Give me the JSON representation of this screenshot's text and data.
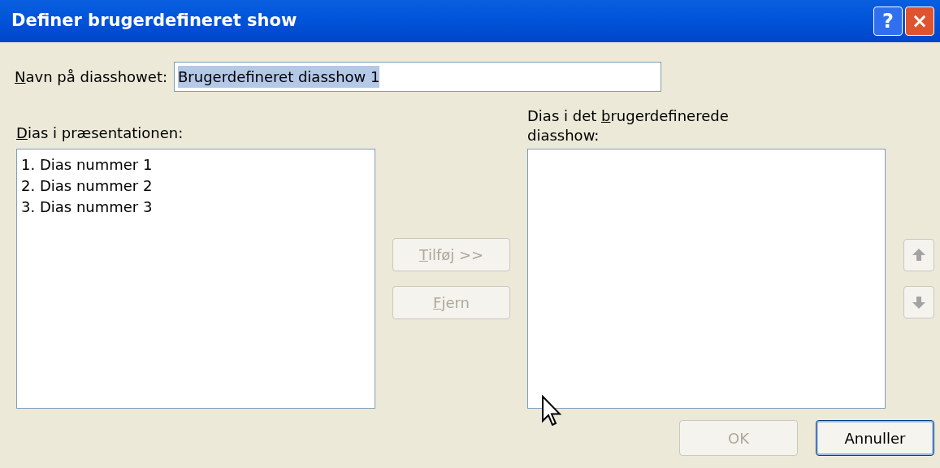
{
  "window": {
    "title": "Definer brugerdefineret show"
  },
  "title_buttons": [
    {
      "kind": "help",
      "label": "?"
    },
    {
      "kind": "close",
      "label": "×"
    }
  ],
  "name_field": {
    "label": {
      "key": "N",
      "post": "avn på diasshowet:"
    },
    "value": "Brugerdefineret diasshow 1",
    "selected": true
  },
  "left_list": {
    "label": {
      "key": "D",
      "post": "ias i præsentationen:"
    },
    "items": [
      {
        "text": "1. Dias nummer 1",
        "selected": false
      },
      {
        "text": "2. Dias nummer 2",
        "selected": false
      },
      {
        "text": "3. Dias nummer 3",
        "selected": false
      }
    ]
  },
  "middle_buttons": [
    {
      "label": {
        "key": "T",
        "post": "ilføj >>"
      },
      "disabled": true
    },
    {
      "label": {
        "key": "F",
        "post": "jern"
      },
      "disabled": true
    }
  ],
  "right_list": {
    "label": {
      "pre": "Dias i det ",
      "key": "b",
      "post": "rugerdefinerede diasshow:"
    }
  },
  "order_buttons": [
    {
      "kind": "up",
      "disabled": true
    },
    {
      "kind": "down",
      "disabled": true
    }
  ],
  "footer_buttons": [
    {
      "label": "OK",
      "disabled": true,
      "default": false
    },
    {
      "label": "Annuller",
      "disabled": false,
      "default": true
    }
  ]
}
